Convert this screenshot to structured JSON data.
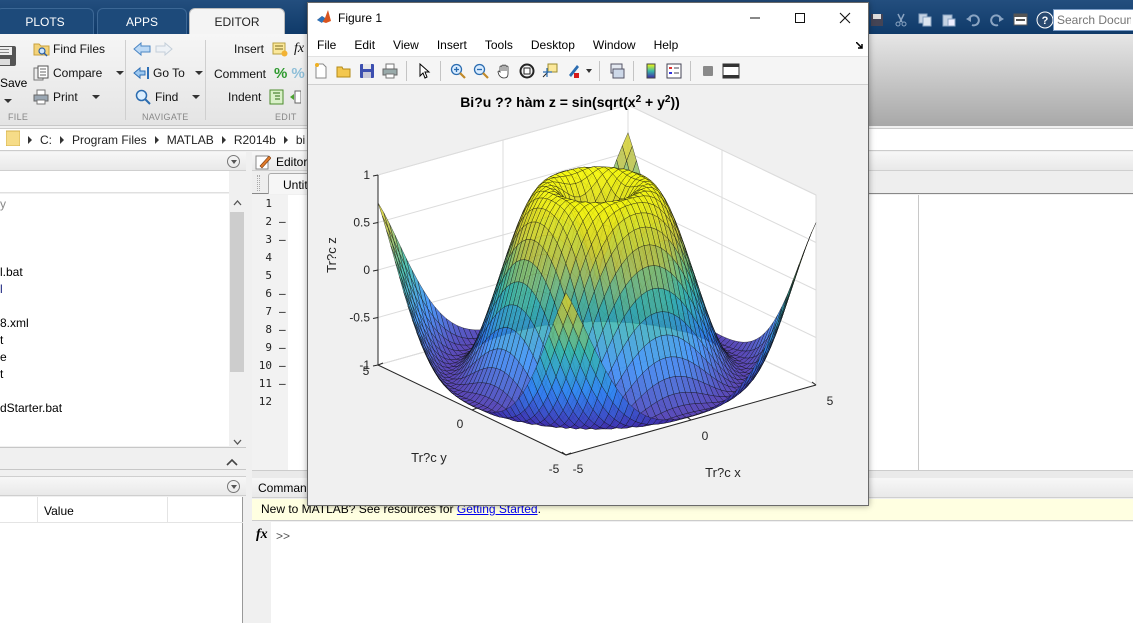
{
  "ribbon": {
    "tabs": [
      {
        "label": "PLOTS"
      },
      {
        "label": "APPS"
      },
      {
        "label": "EDITOR",
        "active": true
      }
    ],
    "file_group": {
      "save_label": "Save",
      "find_files": "Find Files",
      "compare": "Compare",
      "print": "Print",
      "section": "FILE"
    },
    "navigate_group": {
      "goto": "Go To",
      "find": "Find",
      "section": "NAVIGATE"
    },
    "edit_group": {
      "insert": "Insert",
      "comment": "Comment",
      "indent": "Indent",
      "section": "EDIT"
    },
    "search_placeholder": "Search Documentation"
  },
  "address_bar": {
    "path": [
      "C:",
      "Program Files",
      "MATLAB",
      "R2014b",
      "bi"
    ]
  },
  "current_folder": {
    "files": [
      "y",
      "",
      "",
      "",
      "l.bat",
      "l",
      "",
      "8.xml",
      "t",
      "e",
      "t",
      "",
      "dStarter.bat"
    ]
  },
  "workspace": {
    "columns": [
      "Value"
    ]
  },
  "editor": {
    "title": "Editor",
    "tab": "Untitled",
    "lines": [
      {
        "n": "1",
        "dash": false
      },
      {
        "n": "2",
        "dash": true
      },
      {
        "n": "3",
        "dash": true
      },
      {
        "n": "4",
        "dash": false
      },
      {
        "n": "5",
        "dash": false
      },
      {
        "n": "6",
        "dash": true
      },
      {
        "n": "7",
        "dash": true
      },
      {
        "n": "8",
        "dash": true
      },
      {
        "n": "9",
        "dash": true
      },
      {
        "n": "10",
        "dash": true
      },
      {
        "n": "11",
        "dash": true
      },
      {
        "n": "12",
        "dash": false
      }
    ]
  },
  "command_window": {
    "title": "Command Window",
    "banner_prefix": "New to MATLAB? See resources for ",
    "banner_link": "Getting Started",
    "banner_suffix": ".",
    "prompt": ">>",
    "fx_label": "fx"
  },
  "figure": {
    "title": "Figure 1",
    "menu": [
      "File",
      "Edit",
      "View",
      "Insert",
      "Tools",
      "Desktop",
      "Window",
      "Help"
    ],
    "toolbar": [
      "new-figure",
      "open-file",
      "save-figure",
      "print-figure",
      "edit-plot",
      "zoom-in",
      "zoom-out",
      "pan",
      "rotate-3d",
      "data-cursor",
      "brush",
      "link-plot",
      "insert-colorbar",
      "insert-legend",
      "hide-plot-tools",
      "show-plot-tools"
    ]
  },
  "chart_data": {
    "type": "surface",
    "title": "Bi?u ?? hàm z = sin(sqrt(x² + y²))",
    "title_parts": {
      "prefix": "Bi?u ?? hàm z = sin(sqrt(x",
      "sup1": "2",
      "mid": " + y",
      "sup2": "2",
      "suffix": "))"
    },
    "function": "z = sin(sqrt(x^2 + y^2))",
    "xlabel": "Tr?c x",
    "ylabel": "Tr?c y",
    "zlabel": "Tr?c z",
    "xlim": [
      -5,
      5
    ],
    "ylim": [
      -5,
      5
    ],
    "zlim": [
      -1,
      1
    ],
    "xticks": [
      "-5",
      "0",
      "5"
    ],
    "yticks": [
      "-5",
      "0",
      "5"
    ],
    "zticks": [
      "-1",
      "-0.5",
      "0",
      "0.5",
      "1"
    ],
    "grid": true,
    "colormap": "parula",
    "grid_points": 100
  }
}
